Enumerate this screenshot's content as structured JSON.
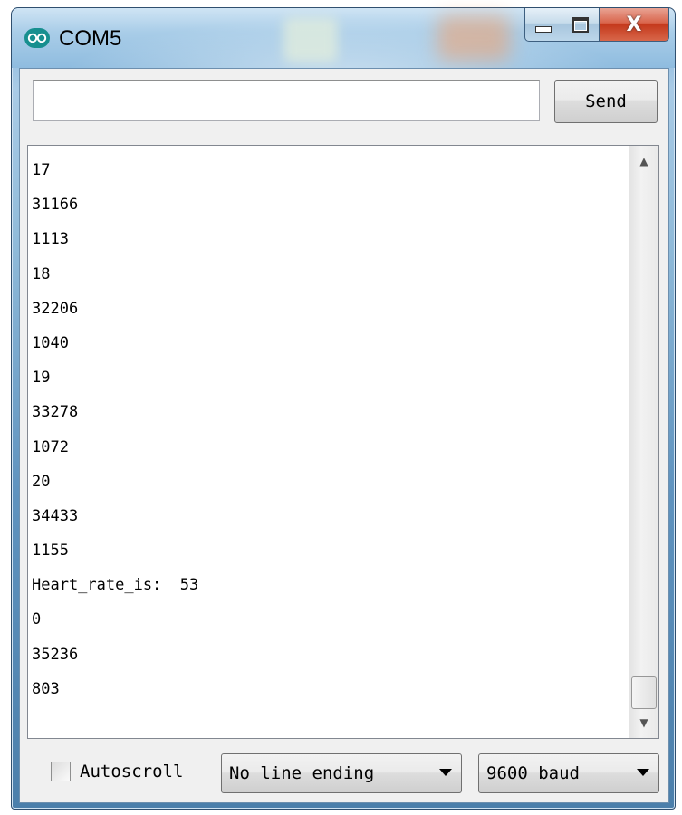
{
  "window": {
    "title": "COM5",
    "close_glyph": "X"
  },
  "input": {
    "value": "",
    "placeholder": ""
  },
  "send_button": {
    "label": "Send"
  },
  "output": {
    "lines": [
      "17",
      "31166",
      "1113",
      "18",
      "32206",
      "1040",
      "19",
      "33278",
      "1072",
      "20",
      "34433",
      "1155",
      "Heart_rate_is:  53",
      "0",
      "35236",
      "803"
    ]
  },
  "footer": {
    "autoscroll_label": "Autoscroll",
    "autoscroll_checked": false,
    "line_ending": "No line ending",
    "baud_rate": "9600 baud"
  },
  "icons": {
    "app": "arduino-icon",
    "minimize": "minimize-icon",
    "maximize": "maximize-icon",
    "close": "close-icon",
    "scroll_up": "scroll-up-icon",
    "scroll_down": "scroll-down-icon",
    "dropdown": "chevron-down-icon"
  },
  "colors": {
    "arduino_teal": "#178f8f",
    "close_red": "#c4391c"
  }
}
